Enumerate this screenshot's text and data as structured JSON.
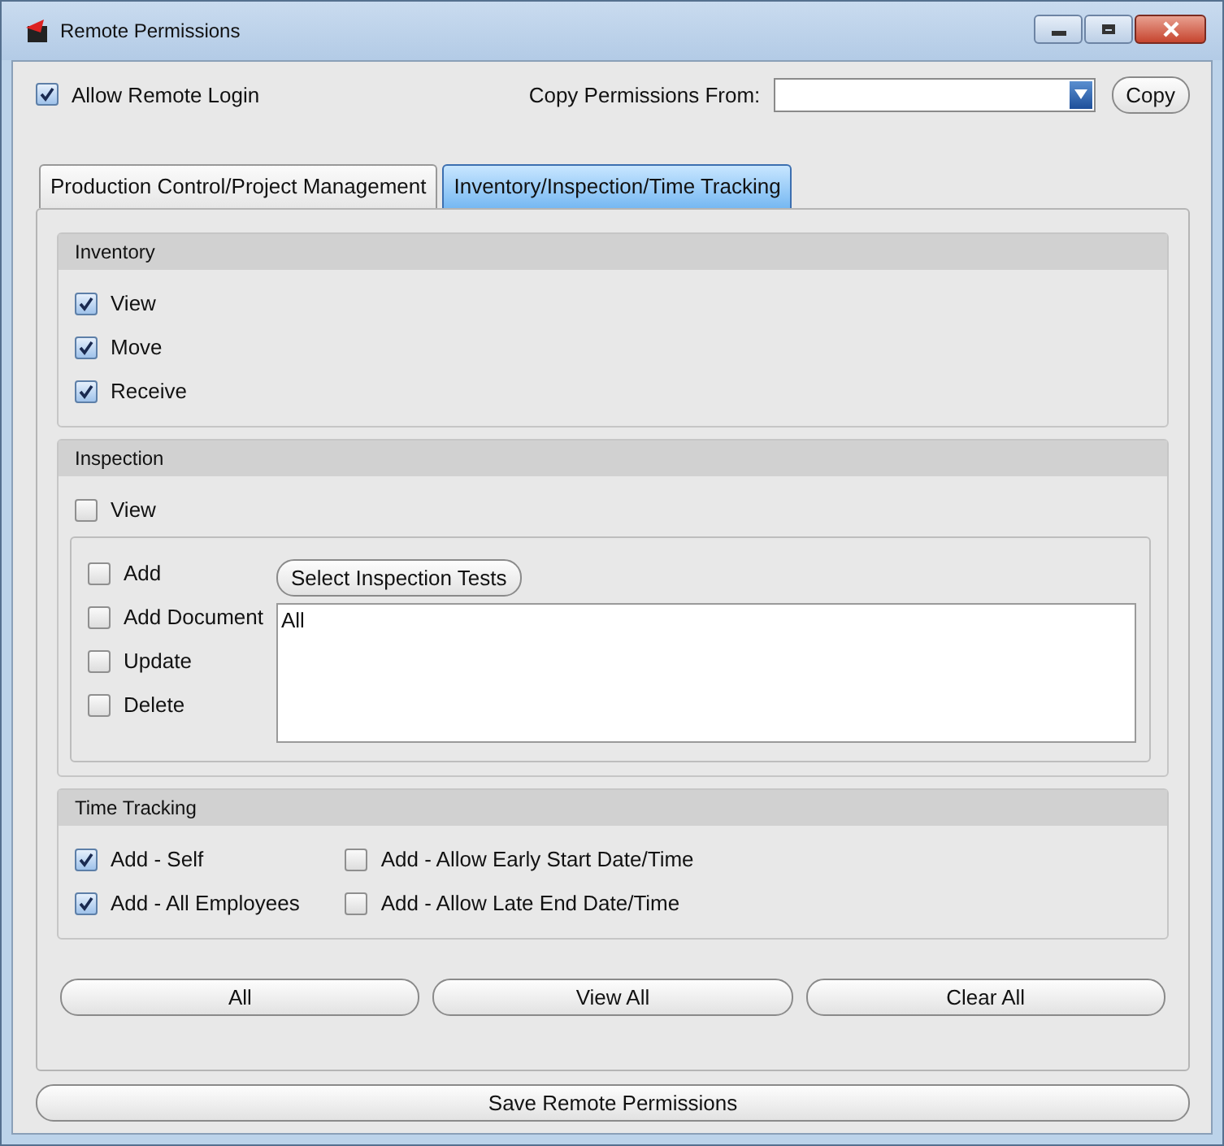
{
  "window": {
    "title": "Remote Permissions"
  },
  "allow_remote_login": {
    "label": "Allow Remote Login",
    "checked": true
  },
  "copy_from": {
    "label": "Copy Permissions From:"
  },
  "copy_button": "Copy",
  "tabs": [
    {
      "label": "Production Control/Project Management",
      "selected": false
    },
    {
      "label": "Inventory/Inspection/Time Tracking",
      "selected": true
    }
  ],
  "inventory": {
    "title": "Inventory",
    "items": [
      {
        "label": "View",
        "checked": true
      },
      {
        "label": "Move",
        "checked": true
      },
      {
        "label": "Receive",
        "checked": true
      }
    ]
  },
  "inspection": {
    "title": "Inspection",
    "view": {
      "label": "View",
      "checked": false
    },
    "items": [
      {
        "label": "Add",
        "checked": false
      },
      {
        "label": "Add Document",
        "checked": false
      },
      {
        "label": "Update",
        "checked": false
      },
      {
        "label": "Delete",
        "checked": false
      }
    ],
    "select_button": "Select Inspection Tests",
    "tests": [
      "All"
    ]
  },
  "time_tracking": {
    "title": "Time Tracking",
    "columns": [
      [
        {
          "label": "Add - Self",
          "checked": true
        },
        {
          "label": "Add - All Employees",
          "checked": true
        }
      ],
      [
        {
          "label": "Add - Allow Early Start Date/Time",
          "checked": false
        },
        {
          "label": "Add - Allow Late End Date/Time",
          "checked": false
        }
      ]
    ]
  },
  "action_buttons": [
    "All",
    "View All",
    "Clear All"
  ],
  "save_button": "Save Remote Permissions"
}
